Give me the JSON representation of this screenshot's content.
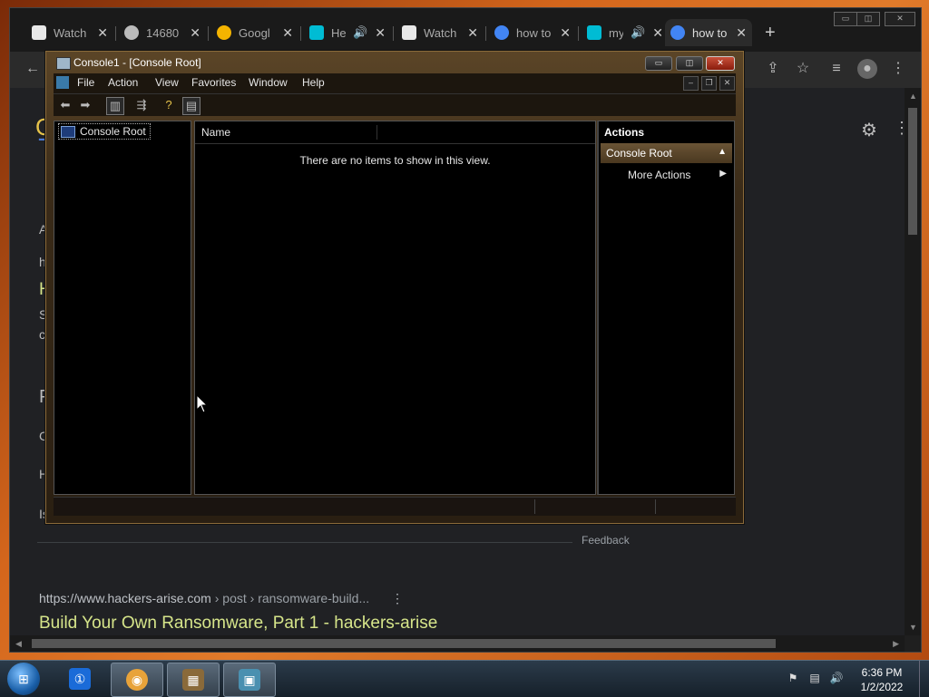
{
  "browser": {
    "tabs": [
      {
        "label": "Watch",
        "favicon": "watch-icon",
        "color": "#e8e8e8"
      },
      {
        "label": "14680",
        "favicon": "globe-icon",
        "color": "#bbbbbb"
      },
      {
        "label": "Googl",
        "favicon": "google-lens-icon",
        "color": "#f4b400"
      },
      {
        "label": "He",
        "favicon": "youtube-icon",
        "color": "#00bcd4"
      },
      {
        "label": "Watch",
        "favicon": "watch-icon",
        "color": "#e8e8e8"
      },
      {
        "label": "how to",
        "favicon": "google-icon",
        "color": "#4285f4"
      },
      {
        "label": "my",
        "favicon": "youtube-icon",
        "color": "#00bcd4"
      },
      {
        "label": "how to",
        "favicon": "google-icon",
        "color": "#4285f4"
      }
    ],
    "new_tab": "+",
    "page": {
      "fragments": [
        "G",
        "A",
        "h",
        "H",
        "S",
        "c",
        "P",
        "C",
        "H",
        "Is"
      ],
      "feedback": "Feedback",
      "result": {
        "domain": "https://www.hackers-arise.com",
        "path": " › post › ransomware-build...",
        "title": "Build Your Own Ransomware, Part 1 - hackers-arise"
      }
    }
  },
  "mmc": {
    "title": "Console1 - [Console Root]",
    "menu": [
      "File",
      "Action",
      "View",
      "Favorites",
      "Window",
      "Help"
    ],
    "tree": {
      "root_label": "Console Root"
    },
    "list": {
      "column_name": "Name",
      "empty_text": "There are no items to show in this view."
    },
    "actions": {
      "header": "Actions",
      "section": "Console Root",
      "more": "More Actions"
    }
  },
  "taskbar": {
    "apps": [
      {
        "name": "1password",
        "color": "#1a6bd8"
      },
      {
        "name": "chrome",
        "color": "#e8a33a"
      },
      {
        "name": "control-panel",
        "color": "#8a6a3a"
      },
      {
        "name": "mmc",
        "color": "#4a90b0"
      }
    ],
    "time": "6:36 PM",
    "date": "1/2/2022"
  }
}
